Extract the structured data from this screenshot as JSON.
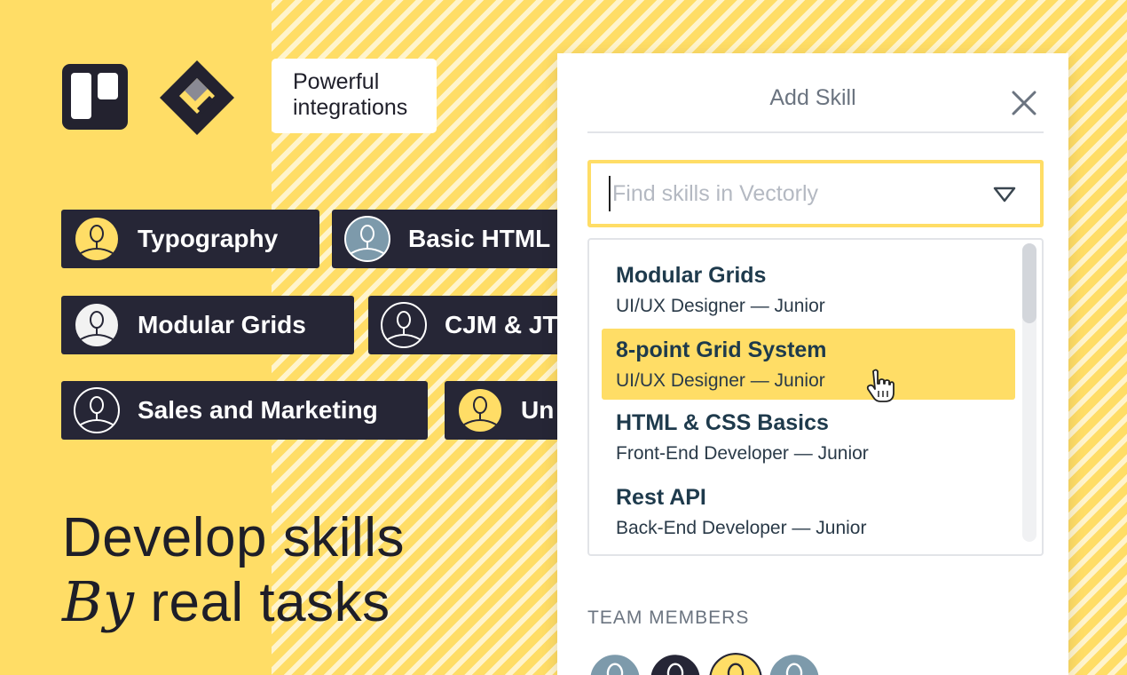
{
  "brand": {
    "tagline_lines": [
      "Powerful",
      "integrations"
    ]
  },
  "logos": [
    "trello-logo",
    "jira-logo"
  ],
  "chips": [
    {
      "label": "Typography",
      "avatar_color": "#FFDD66"
    },
    {
      "label": "Basic HTML",
      "avatar_color": "#7D9AAB"
    },
    {
      "label": "Modular Grids",
      "avatar_color": "#F2F2F2"
    },
    {
      "label": "CJM & JTBD",
      "avatar_color": "#262636"
    },
    {
      "label": "Sales and Marketing",
      "avatar_color": "#262636"
    },
    {
      "label": "Un",
      "avatar_color": "#FFDD66"
    }
  ],
  "headline": {
    "line1": "Develop skills",
    "line2_script": "By",
    "line2_rest": " real tasks"
  },
  "panel": {
    "title": "Add Skill",
    "close_icon": "close-icon",
    "search": {
      "placeholder": "Find skills in Vectorly",
      "value": ""
    },
    "items": [
      {
        "title": "Modular Grids",
        "subtitle": "UI/UX Designer — Junior",
        "active": false
      },
      {
        "title": "8-point Grid System",
        "subtitle": "UI/UX Designer — Junior",
        "active": true
      },
      {
        "title": "HTML & CSS Basics",
        "subtitle": "Front-End Developer — Junior",
        "active": false
      },
      {
        "title": "Rest API",
        "subtitle": "Back-End Developer — Junior",
        "active": false
      }
    ],
    "team_label": "TEAM MEMBERS",
    "team_members": [
      {
        "avatar_color": "#7D9AAB"
      },
      {
        "avatar_color": "#262636"
      },
      {
        "avatar_color": "#FFDD66"
      },
      {
        "avatar_color": "#7D9AAB"
      }
    ]
  },
  "colors": {
    "accent_yellow": "#FFDD66",
    "chip_dark": "#262636",
    "slate_blue": "#7D9AAB"
  }
}
